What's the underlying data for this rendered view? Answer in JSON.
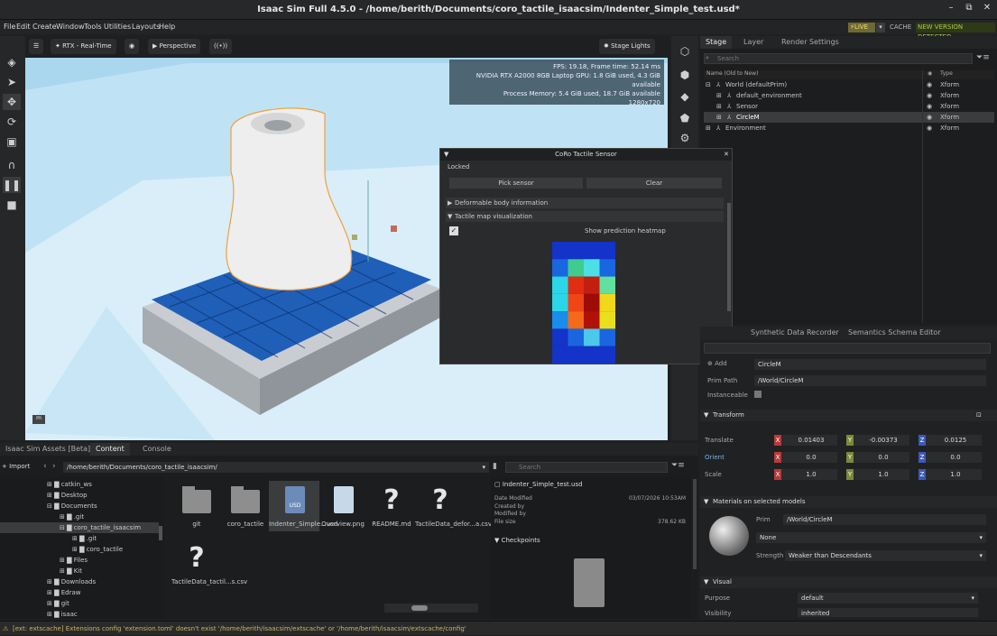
{
  "window": {
    "title": "Isaac Sim Full 4.5.0 - /home/berith/Documents/coro_tactile_isaacsim/Indenter_Simple_test.usd*",
    "controls": [
      "–",
      "⧉",
      "✕"
    ]
  },
  "menu": [
    "File",
    "Edit",
    "Create",
    "Window",
    "Tools",
    "Utilities",
    "Layouts",
    "Help"
  ],
  "status_top": {
    "live": "⚡LIVE",
    "cache": "CACHE",
    "new_version": "NEW VERSION DETECTED"
  },
  "viewport": {
    "render_mode": "RTX - Real-Time",
    "camera": "Perspective",
    "lights": "Stage Lights",
    "stats": [
      "FPS: 19.18, Frame time: 52.14 ms",
      "NVIDIA RTX A2000 8GB Laptop GPU: 1.8 GiB used, 4.3 GiB available",
      "Process Memory: 5.4 GiB used, 18.7 GiB available",
      "1280x720"
    ],
    "axis_label": "m"
  },
  "stage": {
    "tabs": [
      "Stage",
      "Layer",
      "Render Settings"
    ],
    "search_placeholder": "Search",
    "columns": [
      "Name (Old to New)",
      "Type"
    ],
    "rows": [
      {
        "name": "World (defaultPrim)",
        "type": "Xform"
      },
      {
        "name": "default_environment",
        "type": "Xform"
      },
      {
        "name": "Sensor",
        "type": "Xform"
      },
      {
        "name": "CircleM",
        "type": "Xform"
      },
      {
        "name": "Environment",
        "type": "Xform"
      }
    ]
  },
  "tactile": {
    "title": "CoRo Tactile Sensor",
    "locked": "Locked",
    "pick": "Pick sensor",
    "clear": "Clear",
    "deformable": "Deformable body information",
    "map": "Tactile map visualization",
    "heatmap_label": "Show prediction heatmap",
    "heatmap": [
      [
        "#1433c8",
        "#1433c8",
        "#1433c8",
        "#1433c8"
      ],
      [
        "#1a66e0",
        "#3ecc8f",
        "#4be0e6",
        "#1a66e0"
      ],
      [
        "#2bd6e8",
        "#e02e12",
        "#c21f10",
        "#62e0a0"
      ],
      [
        "#2bd6e8",
        "#f04515",
        "#9e0c0a",
        "#f2d81a"
      ],
      [
        "#1a8cea",
        "#f56a18",
        "#b01208",
        "#e9e01c"
      ],
      [
        "#1433c8",
        "#1a66e0",
        "#4bc8ea",
        "#1a66e0"
      ],
      [
        "#1433c8",
        "#1433c8",
        "#1433c8",
        "#1433c8"
      ]
    ]
  },
  "props": {
    "tabs": [
      "Synthetic Data Recorder",
      "Semantics Schema Editor"
    ],
    "add_label": "Add",
    "name": "CircleM",
    "prim_path_label": "Prim Path",
    "prim_path": "/World/CircleM",
    "instanceable": "Instanceable",
    "transform": "Transform",
    "translate": {
      "label": "Translate",
      "x": "0.01403",
      "y": "-0.00373",
      "z": "0.0125"
    },
    "orient": {
      "label": "Orient",
      "x": "0.0",
      "y": "0.0",
      "z": "0.0"
    },
    "scale": {
      "label": "Scale",
      "x": "1.0",
      "y": "1.0",
      "z": "1.0"
    },
    "materials": "Materials on selected models",
    "prim_label": "Prim",
    "prim_value": "/World/CircleM",
    "material": "None",
    "strength_label": "Strength",
    "strength": "Weaker than Descendants",
    "visual": "Visual",
    "purpose_label": "Purpose",
    "purpose": "default",
    "visibility_label": "Visibility",
    "visibility": "inherited"
  },
  "content": {
    "tabs": [
      "Isaac Sim Assets [Beta]",
      "Content",
      "Console"
    ],
    "import": "+ Import",
    "path": "/home/berith/Documents/coro_tactile_isaacsim/",
    "search_placeholder": "Search",
    "tree": [
      "catkin_ws",
      "Desktop",
      "Documents",
      ".git",
      "coro_tactile_isaacsim",
      ".git",
      "coro_tactile",
      "Files",
      "Kit",
      "Downloads",
      "Edraw",
      "git",
      "isaac"
    ],
    "files": [
      "git",
      "coro_tactile",
      "Indenter_Simple...usd",
      "Overview.png",
      "README.md",
      "TactileData_defor...a.csv",
      "TactileData_tactil...s.csv"
    ],
    "detail_title": "Indenter_Simple_test.usd",
    "detail": [
      {
        "k": "Date Modified",
        "v": "03/07/2026 10:53AM"
      },
      {
        "k": "Created by",
        "v": ""
      },
      {
        "k": "Modified by",
        "v": ""
      },
      {
        "k": "File size",
        "v": "378.62 KB"
      }
    ],
    "checkpoints": "Checkpoints"
  },
  "statusbar": "[ext: extscache] Extensions config 'extension.toml' doesn't exist '/home/berith/isaacsim/extscache' or '/home/berith/isaacsim/extscache/config'"
}
